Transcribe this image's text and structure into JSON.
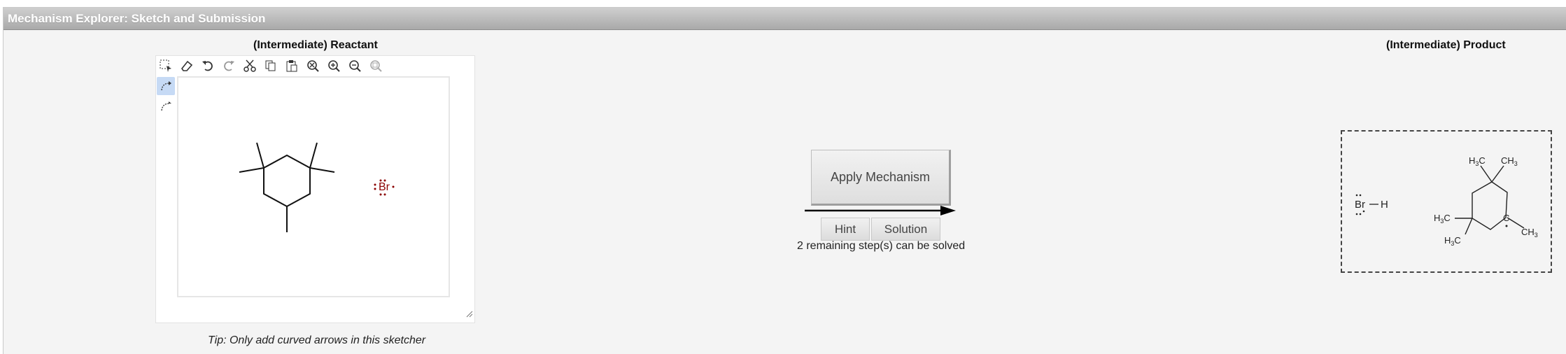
{
  "window": {
    "title": "Mechanism Explorer: Sketch and Submission"
  },
  "reactant": {
    "heading": "(Intermediate) Reactant"
  },
  "product": {
    "heading": "(Intermediate) Product",
    "labels": {
      "br": "Br",
      "h": "H",
      "c": "C"
    }
  },
  "toolbar": {
    "tools": [
      "select-icon",
      "eraser-icon",
      "undo-icon",
      "redo-icon",
      "cut-icon",
      "copy-icon",
      "paste-icon",
      "clear-icon",
      "zoom-in-icon",
      "zoom-out-icon",
      "zoom-fit-icon"
    ],
    "side_tools": [
      "curved-arrow-electron-pair-icon",
      "curved-arrow-single-electron-icon"
    ]
  },
  "reactant_structure": {
    "bromide_label": "Br"
  },
  "tip": "Tip: Only add curved arrows in this sketcher",
  "actions": {
    "apply_label": "Apply Mechanism",
    "hint_label": "Hint",
    "solution_label": "Solution",
    "status": "2 remaining step(s) can be solved"
  },
  "colors": {
    "titlebar": "#b5b5b5",
    "panel": "#f4f4f4",
    "active_tool": "#c6daf5",
    "bromine": "#8b0000"
  }
}
